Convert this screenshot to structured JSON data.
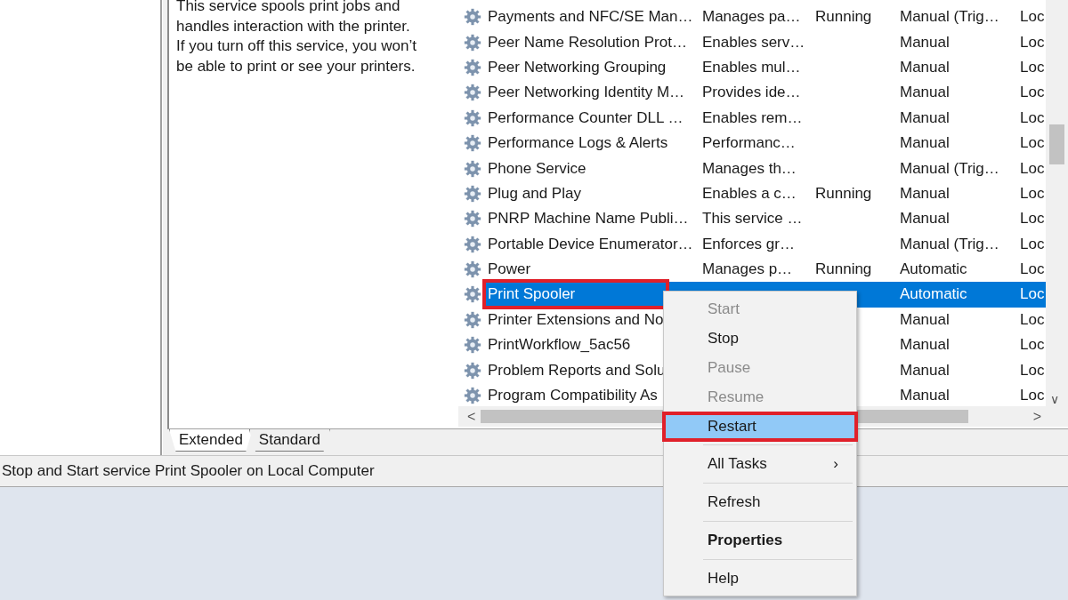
{
  "description": "This service spools print jobs and handles interaction with the printer. If you turn off this service, you won’t be able to print or see your printers.",
  "services": [
    {
      "name": "Payments and NFC/SE Man…",
      "description": "Manages pa…",
      "status": "Running",
      "startup_type": "Manual (Trig…",
      "log_on": "Loc",
      "selected": false,
      "annotated": false
    },
    {
      "name": "Peer Name Resolution Prot…",
      "description": "Enables serv…",
      "startup_type": "Manual",
      "log_on": "Loc",
      "selected": false,
      "annotated": false
    },
    {
      "name": "Peer Networking Grouping",
      "description": "Enables mul…",
      "startup_type": "Manual",
      "log_on": "Loc",
      "selected": false,
      "annotated": false
    },
    {
      "name": "Peer Networking Identity M…",
      "description": "Provides ide…",
      "startup_type": "Manual",
      "log_on": "Loc",
      "selected": false,
      "annotated": false
    },
    {
      "name": "Performance Counter DLL …",
      "description": "Enables rem…",
      "startup_type": "Manual",
      "log_on": "Loc",
      "selected": false,
      "annotated": false
    },
    {
      "name": "Performance Logs & Alerts",
      "description": "Performanc…",
      "startup_type": "Manual",
      "log_on": "Loc",
      "selected": false,
      "annotated": false
    },
    {
      "name": "Phone Service",
      "description": "Manages th…",
      "startup_type": "Manual (Trig…",
      "log_on": "Loc",
      "selected": false,
      "annotated": false
    },
    {
      "name": "Plug and Play",
      "description": "Enables a c…",
      "status": "Running",
      "startup_type": "Manual",
      "log_on": "Loc",
      "selected": false,
      "annotated": false
    },
    {
      "name": "PNRP Machine Name Publi…",
      "description": "This service …",
      "startup_type": "Manual",
      "log_on": "Loc",
      "selected": false,
      "annotated": false
    },
    {
      "name": "Portable Device Enumerator…",
      "description": "Enforces gr…",
      "startup_type": "Manual (Trig…",
      "log_on": "Loc",
      "selected": false,
      "annotated": false
    },
    {
      "name": "Power",
      "description": "Manages p…",
      "status": "Running",
      "startup_type": "Automatic",
      "log_on": "Loc",
      "selected": false,
      "annotated": false
    },
    {
      "name": "Print Spooler",
      "startup_type": "Automatic",
      "log_on": "Loc",
      "selected": true,
      "annotated": true
    },
    {
      "name": "Printer Extensions and No",
      "startup_type": "Manual",
      "log_on": "Loc",
      "selected": false,
      "annotated": false
    },
    {
      "name": "PrintWorkflow_5ac56",
      "startup_type": "Manual",
      "log_on": "Loc",
      "selected": false,
      "annotated": false
    },
    {
      "name": "Problem Reports and Solu",
      "startup_type": "Manual",
      "log_on": "Loc",
      "selected": false,
      "annotated": false
    },
    {
      "name": "Program Compatibility As",
      "startup_type": "Manual",
      "log_on": "Loc",
      "selected": false,
      "annotated": false
    }
  ],
  "tabs": [
    {
      "label": "Extended",
      "selected": true
    },
    {
      "label": "Standard",
      "selected": false
    }
  ],
  "status_bar": "Stop and Start service Print Spooler on Local Computer",
  "context_menu": [
    {
      "kind": "command",
      "label": "Start",
      "disabled": true,
      "bold": false,
      "selected": false,
      "annotated": false
    },
    {
      "kind": "command",
      "label": "Stop",
      "disabled": false,
      "bold": false,
      "selected": false,
      "annotated": false
    },
    {
      "kind": "command",
      "label": "Pause",
      "disabled": true,
      "bold": false,
      "selected": false,
      "annotated": false
    },
    {
      "kind": "command",
      "label": "Resume",
      "disabled": true,
      "bold": false,
      "selected": false,
      "annotated": false
    },
    {
      "kind": "command",
      "label": "Restart",
      "disabled": false,
      "bold": false,
      "selected": true,
      "annotated": true
    },
    {
      "kind": "separator"
    },
    {
      "kind": "submenu",
      "label": "All Tasks",
      "submenu_mark": "›",
      "disabled": false,
      "bold": false,
      "selected": false,
      "annotated": false
    },
    {
      "kind": "separator"
    },
    {
      "kind": "command",
      "label": "Refresh",
      "disabled": false,
      "bold": false,
      "selected": false,
      "annotated": false
    },
    {
      "kind": "separator"
    },
    {
      "kind": "command",
      "label": "Properties",
      "disabled": false,
      "bold": true,
      "selected": false,
      "annotated": false
    },
    {
      "kind": "separator"
    },
    {
      "kind": "command",
      "label": "Help",
      "disabled": false,
      "bold": false,
      "selected": false,
      "annotated": false
    }
  ],
  "scroll_arrows": {
    "down": "∨",
    "left": "<",
    "right": ">"
  }
}
